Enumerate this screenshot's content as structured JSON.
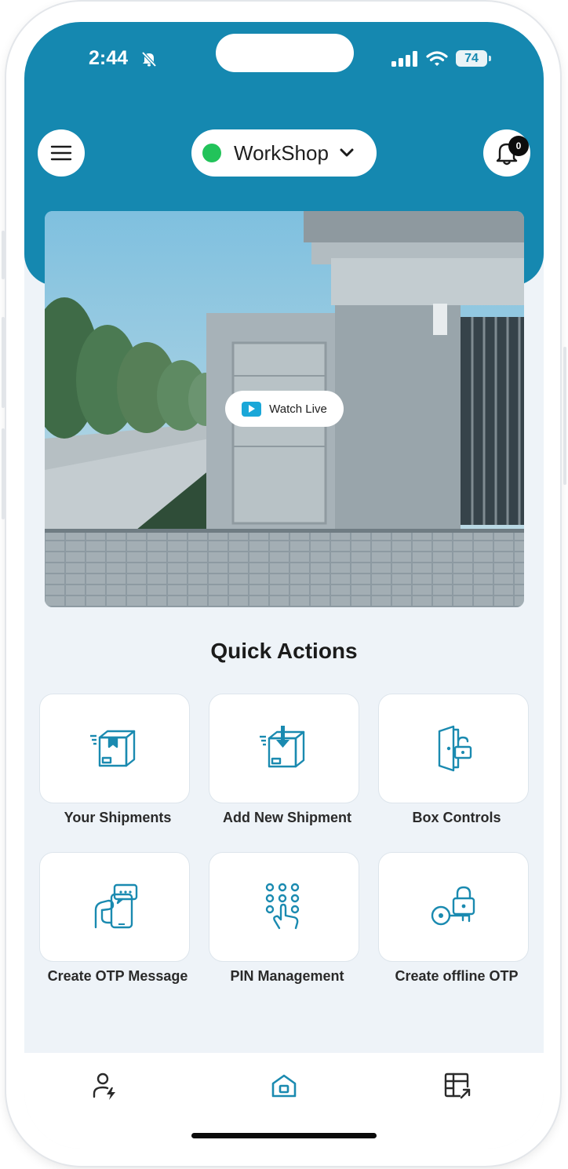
{
  "status_bar": {
    "time": "2:44",
    "battery": "74"
  },
  "header": {
    "location_name": "WorkShop",
    "location_status_color": "#22c35a",
    "notification_count": "0",
    "brand_color": "#1588b0"
  },
  "camera": {
    "watch_label": "Watch Live"
  },
  "quick_actions": {
    "title": "Quick Actions",
    "items": [
      {
        "label": "Your Shipments",
        "icon": "package-box-icon"
      },
      {
        "label": "Add New Shipment",
        "icon": "add-package-icon"
      },
      {
        "label": "Box Controls",
        "icon": "door-unlock-icon"
      },
      {
        "label": "Create OTP Message",
        "icon": "phone-message-icon"
      },
      {
        "label": "PIN Management",
        "icon": "keypad-icon"
      },
      {
        "label": "Create offline OTP",
        "icon": "key-lock-icon"
      }
    ]
  },
  "bottom_nav": [
    {
      "name": "profile",
      "icon": "user-activity-icon"
    },
    {
      "name": "home",
      "icon": "home-icon",
      "active": true
    },
    {
      "name": "dashboard",
      "icon": "table-external-icon"
    }
  ]
}
